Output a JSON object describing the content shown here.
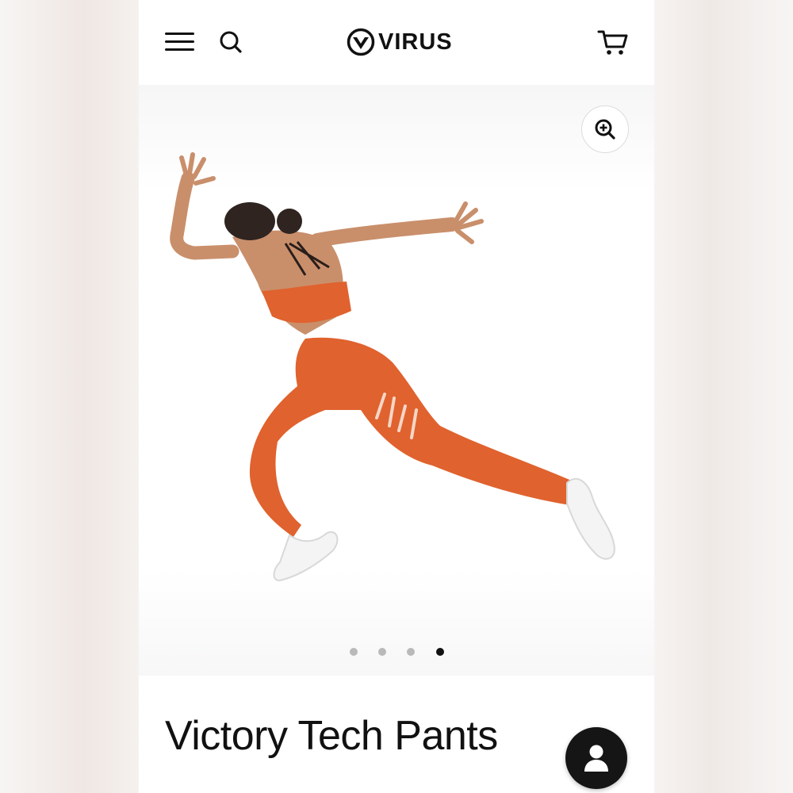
{
  "header": {
    "logo_text": "VIRUS",
    "menu_icon": "hamburger-menu-icon",
    "search_icon": "search-icon",
    "cart_icon": "cart-icon"
  },
  "gallery": {
    "zoom_icon": "zoom-in-icon",
    "slide_count": 4,
    "active_slide": 4,
    "apparel_color": "#e0622e"
  },
  "product": {
    "title": "Victory Tech Pants"
  },
  "floating": {
    "account_icon": "user-icon"
  }
}
